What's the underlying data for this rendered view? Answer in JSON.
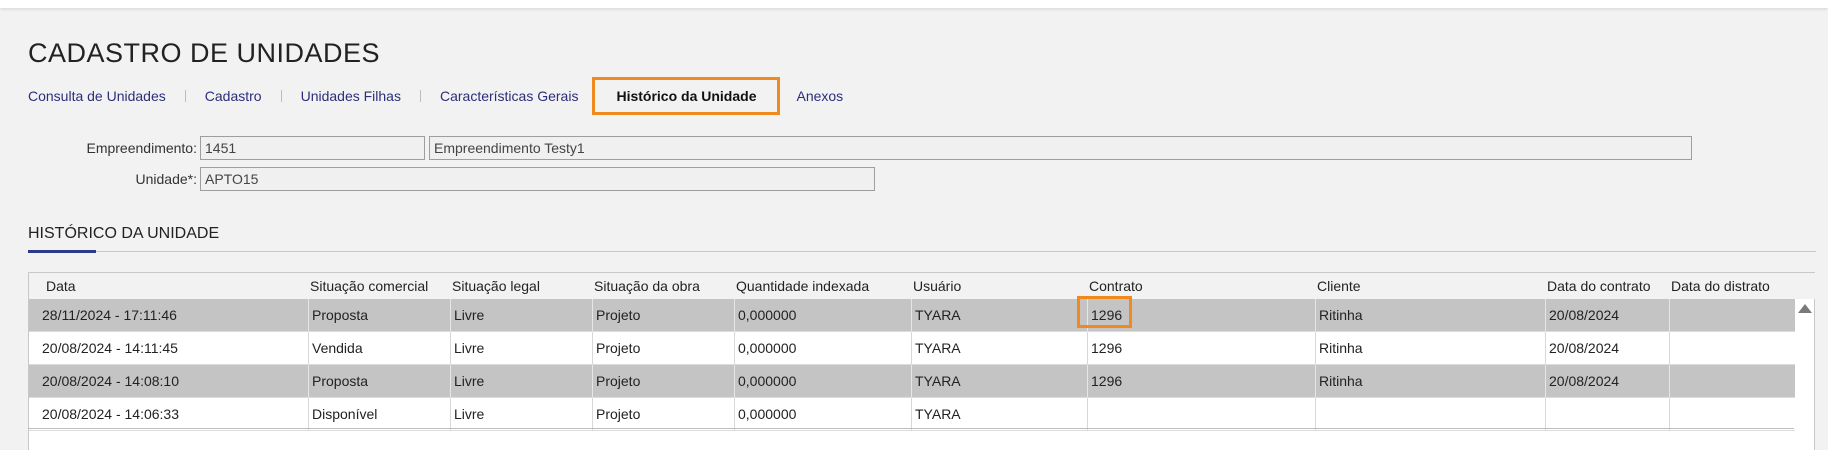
{
  "page": {
    "title": "CADASTRO DE UNIDADES"
  },
  "tabs": [
    {
      "label": "Consulta de Unidades"
    },
    {
      "label": "Cadastro"
    },
    {
      "label": "Unidades Filhas"
    },
    {
      "label": "Características Gerais"
    },
    {
      "label": "Histórico da Unidade",
      "active": true
    },
    {
      "label": "Anexos"
    }
  ],
  "form": {
    "empreendimento_label": "Empreendimento:",
    "empreendimento_code": "1451",
    "empreendimento_name": "Empreendimento Testy1",
    "unidade_label": "Unidade*:",
    "unidade_value": "APTO15"
  },
  "section": {
    "title": "HISTÓRICO DA UNIDADE"
  },
  "grid": {
    "columns": [
      "Data",
      "Situação comercial",
      "Situação legal",
      "Situação da obra",
      "Quantidade indexada",
      "Usuário",
      "Contrato",
      "Cliente",
      "Data do contrato",
      "Data do distrato"
    ],
    "rows": [
      [
        "28/11/2024 - 17:11:46",
        "Proposta",
        "Livre",
        "Projeto",
        "0,000000",
        "TYARA",
        "1296",
        "Ritinha",
        "20/08/2024",
        ""
      ],
      [
        "20/08/2024 - 14:11:45",
        "Vendida",
        "Livre",
        "Projeto",
        "0,000000",
        "TYARA",
        "1296",
        "Ritinha",
        "20/08/2024",
        ""
      ],
      [
        "20/08/2024 - 14:08:10",
        "Proposta",
        "Livre",
        "Projeto",
        "0,000000",
        "TYARA",
        "1296",
        "Ritinha",
        "20/08/2024",
        ""
      ],
      [
        "20/08/2024 - 14:06:33",
        "Disponível",
        "Livre",
        "Projeto",
        "0,000000",
        "TYARA",
        "",
        "",
        "",
        ""
      ]
    ]
  },
  "colors": {
    "accent": "#f08a1c",
    "link": "#2b2e7a",
    "row_shaded": "#c4c4c4"
  },
  "icons": {
    "scroll_up": "triangle-up-icon"
  }
}
